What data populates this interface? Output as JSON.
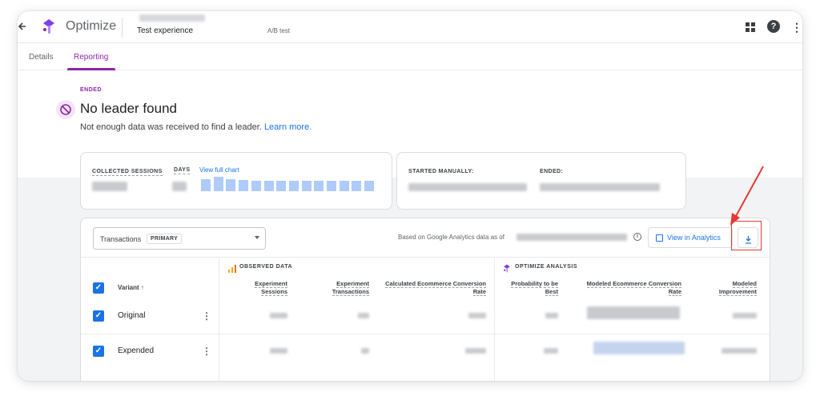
{
  "header": {
    "back_icon": "arrow-left-icon",
    "app_name": "Optimize",
    "experience_name": "Test experience",
    "experience_type": "A/B test",
    "icons": [
      "apps-grid-icon",
      "help-icon",
      "more-vert-icon"
    ]
  },
  "tabs": [
    {
      "label": "Details",
      "active": false
    },
    {
      "label": "Reporting",
      "active": true
    }
  ],
  "status": {
    "label": "ENDED",
    "headline": "No leader found",
    "message": "Not enough data was received to find a leader.",
    "learn_more": "Learn more."
  },
  "summary": {
    "collected_sessions_label": "COLLECTED SESSIONS",
    "days_label": "DAYS",
    "view_full_chart": "View full chart",
    "sessions_bar_levels": [
      0.85,
      1.0,
      0.85,
      0.8,
      0.72,
      0.72,
      0.72,
      0.72,
      0.72,
      0.72,
      0.72,
      0.72,
      0.72,
      0.72
    ],
    "started_label": "STARTED MANUALLY:",
    "ended_label": "ENDED:"
  },
  "toolbar": {
    "objective_select": "Transactions",
    "primary_badge": "PRIMARY",
    "based_on_text": "Based on Google Analytics data as of",
    "view_in_analytics": "View in Analytics",
    "download_icon": "download-icon"
  },
  "table": {
    "observed_header": "OBSERVED DATA",
    "optimize_header": "OPTIMIZE ANALYSIS",
    "variant_header": "Variant ↑",
    "columns": [
      "Experiment Sessions",
      "Experiment Transactions",
      "Calculated Ecommerce Conversion Rate",
      "Probability to be Best",
      "Modeled Ecommerce Conversion Rate",
      "Modeled Improvement"
    ],
    "rows": [
      {
        "label": "Original",
        "checked": true
      },
      {
        "label": "Expended",
        "checked": true
      }
    ]
  },
  "colors": {
    "accent_purple": "#8e24aa",
    "link_blue": "#1a73e8",
    "checkbox_blue": "#1a73e8",
    "bar_blue": "#aecbfa",
    "annotation_red": "#e53935",
    "observed_icon_orange": "#f9ab00"
  }
}
